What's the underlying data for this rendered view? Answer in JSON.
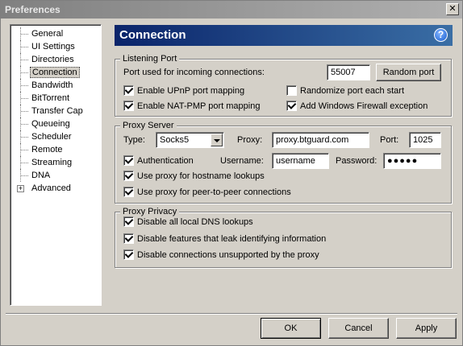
{
  "window": {
    "title": "Preferences",
    "close_label": "✕"
  },
  "sidebar": {
    "items": [
      {
        "label": "General"
      },
      {
        "label": "UI Settings"
      },
      {
        "label": "Directories"
      },
      {
        "label": "Connection",
        "selected": true
      },
      {
        "label": "Bandwidth"
      },
      {
        "label": "BitTorrent"
      },
      {
        "label": "Transfer Cap"
      },
      {
        "label": "Queueing"
      },
      {
        "label": "Scheduler"
      },
      {
        "label": "Remote"
      },
      {
        "label": "Streaming"
      },
      {
        "label": "DNA"
      },
      {
        "label": "Advanced",
        "expandable": true,
        "expander": "+"
      }
    ]
  },
  "header": {
    "title": "Connection",
    "help": "?"
  },
  "listening_port": {
    "title": "Listening Port",
    "port_label": "Port used for incoming connections:",
    "port_value": "55007",
    "random_port_button": "Random port",
    "upnp_label": "Enable UPnP port mapping",
    "upnp_checked": true,
    "natpmp_label": "Enable NAT-PMP port mapping",
    "natpmp_checked": true,
    "randomize_label": "Randomize port each start",
    "randomize_checked": false,
    "firewall_label": "Add Windows Firewall exception",
    "firewall_checked": true
  },
  "proxy_server": {
    "title": "Proxy Server",
    "type_label": "Type:",
    "type_value": "Socks5",
    "proxy_label": "Proxy:",
    "proxy_value": "proxy.btguard.com",
    "port_label": "Port:",
    "port_value": "1025",
    "auth_label": "Authentication",
    "auth_checked": true,
    "username_label": "Username:",
    "username_value": "username",
    "password_label": "Password:",
    "password_value": "●●●●●",
    "hostname_label": "Use proxy for hostname lookups",
    "hostname_checked": true,
    "p2p_label": "Use proxy for peer-to-peer connections",
    "p2p_checked": true
  },
  "proxy_privacy": {
    "title": "Proxy Privacy",
    "dns_label": "Disable all local DNS lookups",
    "dns_checked": true,
    "leak_label": "Disable features that leak identifying information",
    "leak_checked": true,
    "unsupported_label": "Disable connections unsupported by the proxy",
    "unsupported_checked": true
  },
  "footer": {
    "ok": "OK",
    "cancel": "Cancel",
    "apply": "Apply"
  }
}
